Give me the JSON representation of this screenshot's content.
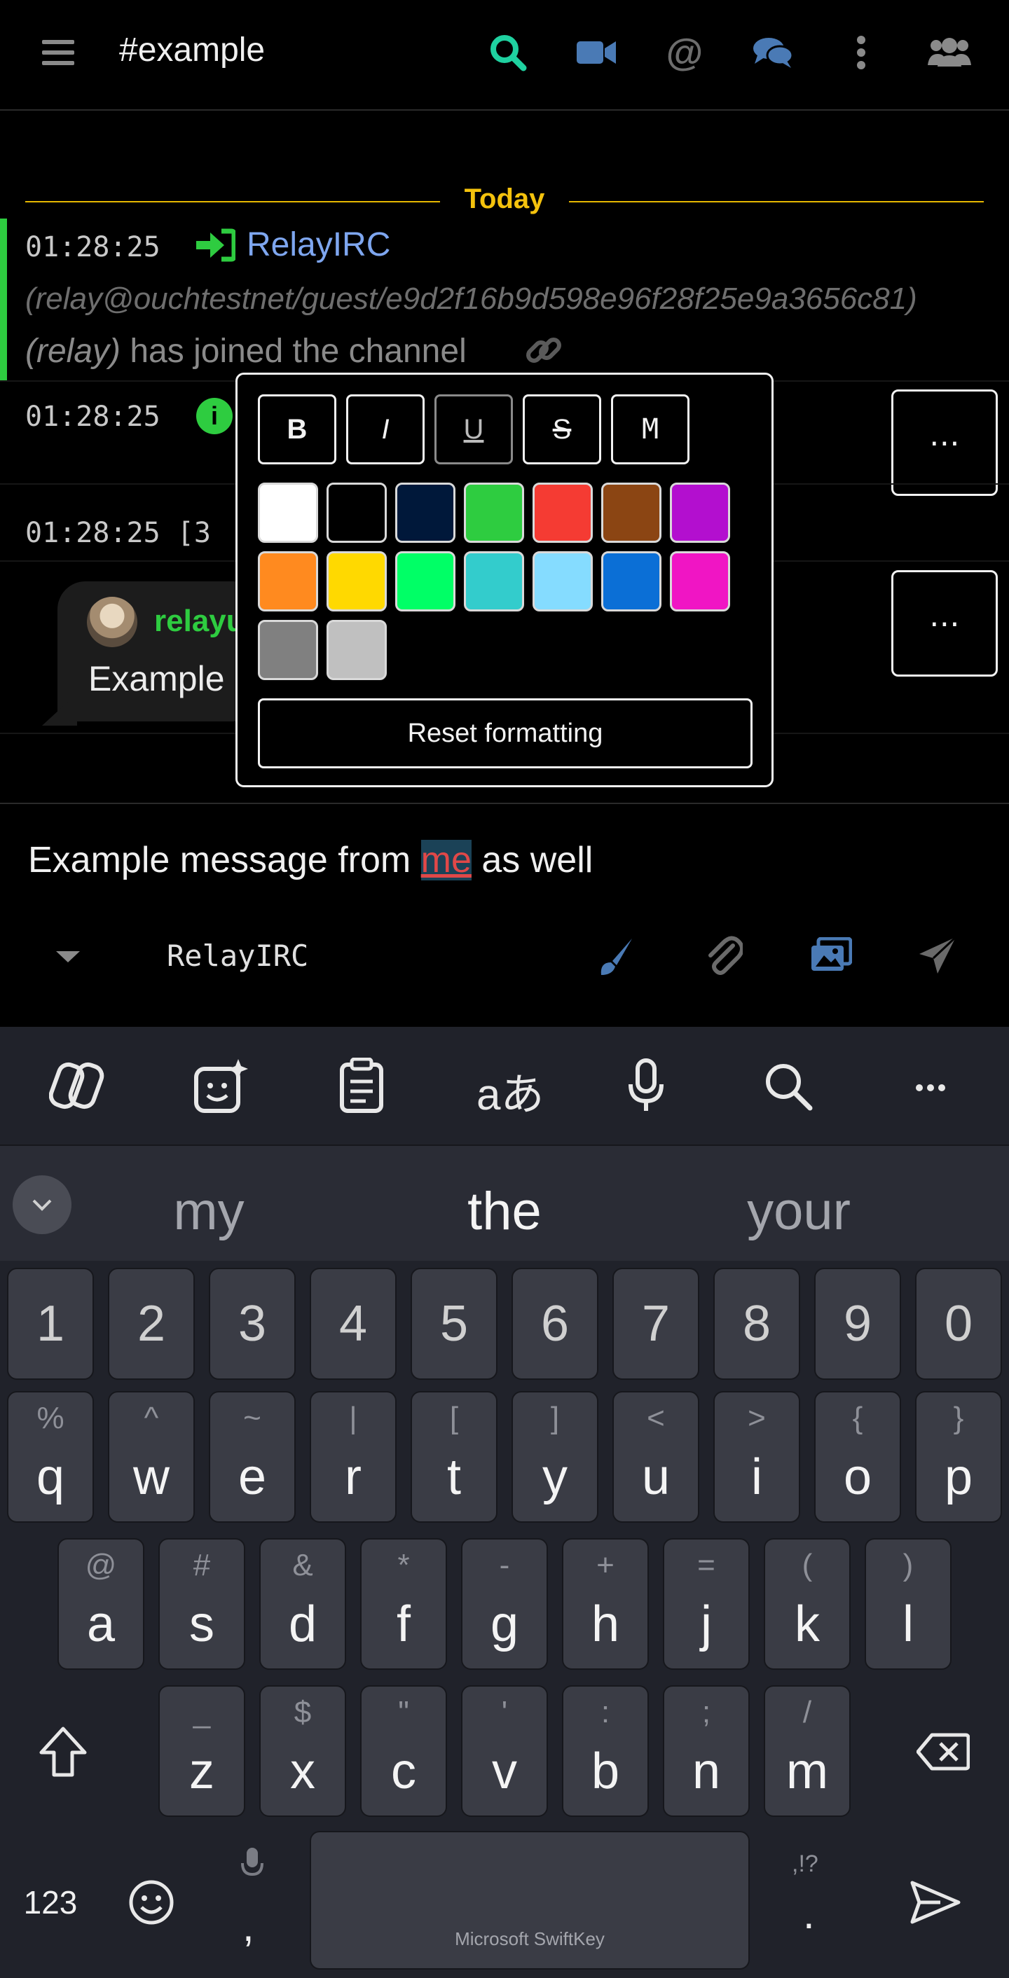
{
  "header": {
    "channel": "#example",
    "icons": [
      "menu-icon",
      "search-icon",
      "video-icon",
      "mention-icon",
      "chat-icon",
      "more-vertical-icon",
      "members-icon"
    ]
  },
  "messages": {
    "divider_label": "Today",
    "join": {
      "time": "01:28:25",
      "nick": "RelayIRC",
      "hostmask": "(relay@ouchtestnet/guest/e9d2f16b9d598e96f28f25e9a3656c81)",
      "who": "(relay)",
      "text": "has joined the channel"
    },
    "info_time": "01:28:25",
    "third_time": "01:28:25",
    "third_prefix": "[3",
    "bubble": {
      "nick": "relayu",
      "text": "Example"
    },
    "more_label": "⋯"
  },
  "format_popup": {
    "buttons": [
      "B",
      "I",
      "U",
      "S",
      "M"
    ],
    "colors": [
      "#ffffff",
      "#000000",
      "#00183a",
      "#2ecc40",
      "#f53b33",
      "#8b4513",
      "#b30fcf",
      "#ff8a1f",
      "#ffd900",
      "#00ff66",
      "#33cccc",
      "#85dcff",
      "#0b6fd6",
      "#f015c4",
      "#808080",
      "#c0c0c0"
    ],
    "reset_label": "Reset formatting"
  },
  "composer": {
    "text_before": "Example message from ",
    "highlighted": "me",
    "text_after": " as well",
    "identity": "RelayIRC"
  },
  "keyboard": {
    "suggestions": [
      "my",
      "the",
      "your"
    ],
    "number_row": [
      "1",
      "2",
      "3",
      "4",
      "5",
      "6",
      "7",
      "8",
      "9",
      "0"
    ],
    "row1": [
      [
        "%",
        "q"
      ],
      [
        "^",
        "w"
      ],
      [
        "~",
        "e"
      ],
      [
        "|",
        "r"
      ],
      [
        "[",
        "t"
      ],
      [
        "]",
        "y"
      ],
      [
        "<",
        "u"
      ],
      [
        ">",
        "i"
      ],
      [
        "{",
        "o"
      ],
      [
        "}",
        "p"
      ]
    ],
    "row2": [
      [
        "@",
        "a"
      ],
      [
        "#",
        "s"
      ],
      [
        "&",
        "d"
      ],
      [
        "*",
        "f"
      ],
      [
        "-",
        "g"
      ],
      [
        "+",
        "h"
      ],
      [
        "=",
        "j"
      ],
      [
        "(",
        "k"
      ],
      [
        ")",
        "l"
      ]
    ],
    "row3": [
      [
        "_",
        "z"
      ],
      [
        "$",
        "x"
      ],
      [
        "\"",
        "c"
      ],
      [
        "'",
        "v"
      ],
      [
        ":",
        "b"
      ],
      [
        ";",
        "n"
      ],
      [
        "/",
        "m"
      ]
    ],
    "symbols_label": "123",
    "comma": ",",
    "period": ".",
    "period_alt": ",!?",
    "space_label": "Microsoft SwiftKey"
  }
}
